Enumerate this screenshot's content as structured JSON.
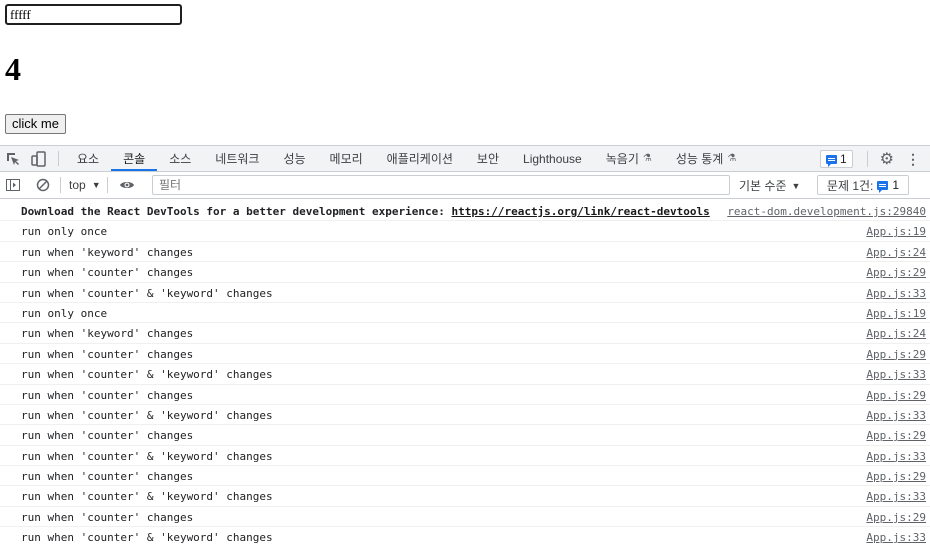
{
  "page": {
    "input_value": "fffff",
    "counter": "4",
    "button_label": "click me"
  },
  "devtools": {
    "tabs": [
      "요소",
      "콘솔",
      "소스",
      "네트워크",
      "성능",
      "메모리",
      "애플리케이션",
      "보안",
      "Lighthouse",
      "녹음기",
      "성능 통계"
    ],
    "active_tab": "콘솔",
    "flask_glyph": "⚗",
    "issue_badge_count": "1",
    "toolbar": {
      "context": "top",
      "filter_placeholder": "필터",
      "level_label": "기본 수준",
      "issues_label": "문제 1건:",
      "issues_count": "1"
    },
    "first_message": {
      "text": "Download the React DevTools for a better development experience: ",
      "link": "https://reactjs.org/link/react-devtools",
      "source": "react-dom.development.js:29840"
    },
    "messages": [
      {
        "text": "run only once",
        "source": "App.js:19"
      },
      {
        "text": "run when 'keyword' changes",
        "source": "App.js:24"
      },
      {
        "text": "run when 'counter' changes",
        "source": "App.js:29"
      },
      {
        "text": "run when 'counter' & 'keyword' changes",
        "source": "App.js:33"
      },
      {
        "text": "run only once",
        "source": "App.js:19"
      },
      {
        "text": "run when 'keyword' changes",
        "source": "App.js:24"
      },
      {
        "text": "run when 'counter' changes",
        "source": "App.js:29"
      },
      {
        "text": "run when 'counter' & 'keyword' changes",
        "source": "App.js:33"
      },
      {
        "text": "run when 'counter' changes",
        "source": "App.js:29"
      },
      {
        "text": "run when 'counter' & 'keyword' changes",
        "source": "App.js:33"
      },
      {
        "text": "run when 'counter' changes",
        "source": "App.js:29"
      },
      {
        "text": "run when 'counter' & 'keyword' changes",
        "source": "App.js:33"
      },
      {
        "text": "run when 'counter' changes",
        "source": "App.js:29"
      },
      {
        "text": "run when 'counter' & 'keyword' changes",
        "source": "App.js:33"
      },
      {
        "text": "run when 'counter' changes",
        "source": "App.js:29"
      },
      {
        "text": "run when 'counter' & 'keyword' changes",
        "source": "App.js:33"
      }
    ],
    "colors": {
      "accent": "#1a73e8",
      "toolbar_bg": "#f1f3f4"
    }
  }
}
